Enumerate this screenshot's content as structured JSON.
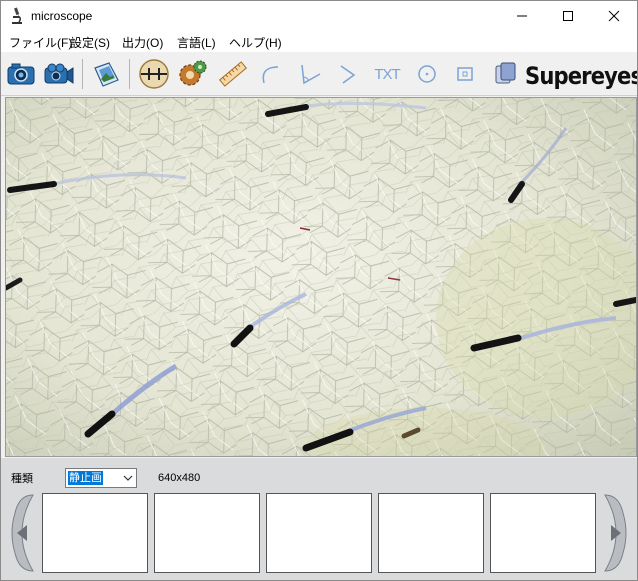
{
  "window": {
    "title": "microscope",
    "controls": {
      "minimize": "minimize",
      "maximize": "maximize",
      "close": "close"
    }
  },
  "menu": {
    "items": [
      {
        "label": "ファイル(F)"
      },
      {
        "label": "設定(S)"
      },
      {
        "label": "出力(O)"
      },
      {
        "label": "言語(L)"
      },
      {
        "label": "ヘルプ(H)"
      }
    ]
  },
  "toolbar": {
    "buttons": [
      {
        "icon": "camera-icon"
      },
      {
        "icon": "video-camera-icon"
      },
      {
        "icon": "photo-album-icon"
      },
      {
        "icon": "crosshair-icon"
      },
      {
        "icon": "settings-gear-icon"
      },
      {
        "icon": "ruler-icon"
      },
      {
        "icon": "arc-tool-icon"
      },
      {
        "icon": "angle-tool-icon"
      },
      {
        "icon": "polyline-tool-icon"
      },
      {
        "icon": "text-tool-icon"
      },
      {
        "icon": "circle-tool-icon"
      },
      {
        "icon": "rectangle-tool-icon"
      },
      {
        "icon": "copy-icon"
      }
    ],
    "text_tool_label": "TXT",
    "brand": "Supereyes"
  },
  "bottom_panel": {
    "type_label": "種類",
    "type_selected": "静止画",
    "resolution": "640x480",
    "thumbnail_count": 5
  },
  "colors": {
    "title_bg": "#ffffff",
    "chrome_bg": "#f0f0f0",
    "bottom_bg": "#d9dbdd",
    "select_highlight": "#0078d7",
    "skin": "#e6e6d4",
    "hair": "#1a1a1a",
    "disabled_tool": "#7aa3d6"
  }
}
